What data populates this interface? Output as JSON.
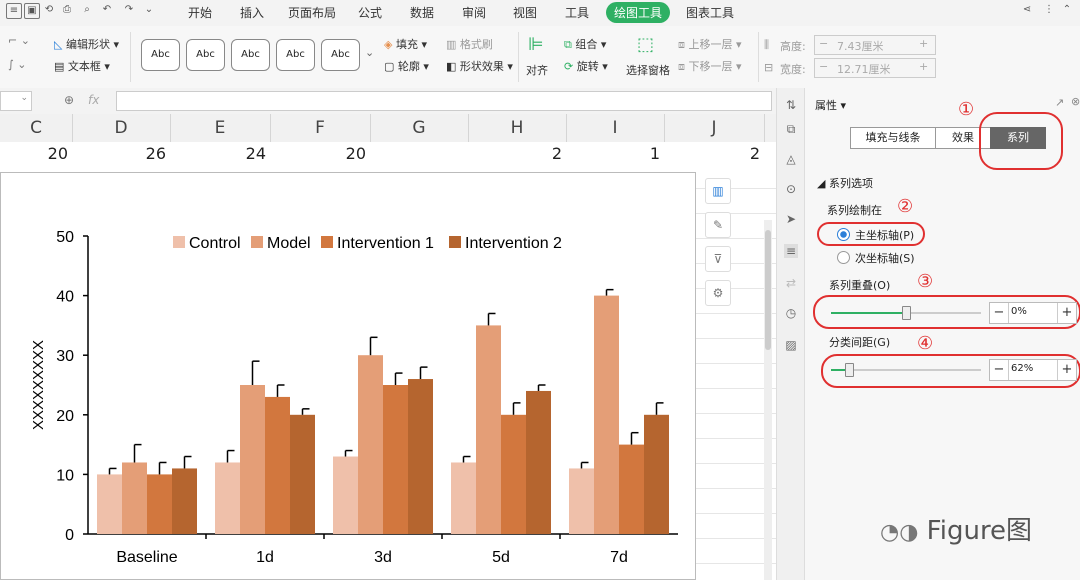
{
  "menu": {
    "items": [
      "开始",
      "插入",
      "页面布局",
      "公式",
      "数据",
      "审阅",
      "视图",
      "工具",
      "绘图工具",
      "图表工具"
    ],
    "active": "绘图工具"
  },
  "ribbon": {
    "edit_shape": "编辑形状",
    "textbox": "文本框",
    "style_sample": "Abc",
    "fill": "填充",
    "format_brush": "格式刷",
    "outline": "轮廓",
    "shape_effect": "形状效果",
    "align": "对齐",
    "group": "组合",
    "rotate": "旋转",
    "select_pane": "选择窗格",
    "bring_forward": "上移一层",
    "send_backward": "下移一层",
    "height_label": "高度:",
    "height_value": "7.43厘米",
    "width_label": "宽度:",
    "width_value": "12.71厘米",
    "style_colors": [
      "#555555",
      "#5b8fd6",
      "#e6904f",
      "#888888",
      "#e8b12b"
    ]
  },
  "formula": {
    "fx": "fx"
  },
  "columns": [
    "C",
    "D",
    "E",
    "F",
    "G",
    "H",
    "I",
    "J"
  ],
  "row_values": [
    "20",
    "26",
    "24",
    "20",
    "",
    "2",
    "1",
    "2"
  ],
  "chart_data": {
    "type": "bar",
    "categories": [
      "Baseline",
      "1d",
      "3d",
      "5d",
      "7d"
    ],
    "series": [
      {
        "name": "Control",
        "color": "#efc0aa",
        "values": [
          10,
          12,
          13,
          12,
          11
        ],
        "errors": [
          1,
          2,
          1,
          1,
          1
        ]
      },
      {
        "name": "Model",
        "color": "#e49e77",
        "values": [
          12,
          25,
          30,
          35,
          40
        ],
        "errors": [
          3,
          4,
          3,
          2,
          1
        ]
      },
      {
        "name": "Intervention 1",
        "color": "#d2773e",
        "values": [
          10,
          23,
          25,
          20,
          15
        ],
        "errors": [
          2,
          2,
          2,
          2,
          2
        ]
      },
      {
        "name": "Intervention 2",
        "color": "#b5652f",
        "values": [
          11,
          20,
          26,
          24,
          20
        ],
        "errors": [
          2,
          1,
          2,
          1,
          2
        ]
      }
    ],
    "ylabel": "XXXXXXXXX",
    "ylim": [
      0,
      50
    ],
    "yticks": [
      "0",
      "10",
      "20",
      "30",
      "40",
      "50"
    ],
    "legend_position": "top",
    "grid": false
  },
  "panel": {
    "title": "属性",
    "tabs": [
      "填充与线条",
      "效果",
      "系列"
    ],
    "active_tab": "系列",
    "section": "系列选项",
    "plot_on": "系列绘制在",
    "primary_axis": "主坐标轴(P)",
    "secondary_axis": "次坐标轴(S)",
    "overlap_label": "系列重叠(O)",
    "overlap_value": "0%",
    "overlap_level": 0.5,
    "gap_label": "分类间距(G)",
    "gap_value": "62%",
    "gap_level": 0.12,
    "markers": [
      "①",
      "②",
      "③",
      "④"
    ],
    "accent_color": "#e03030"
  },
  "watermark": "Figure图"
}
